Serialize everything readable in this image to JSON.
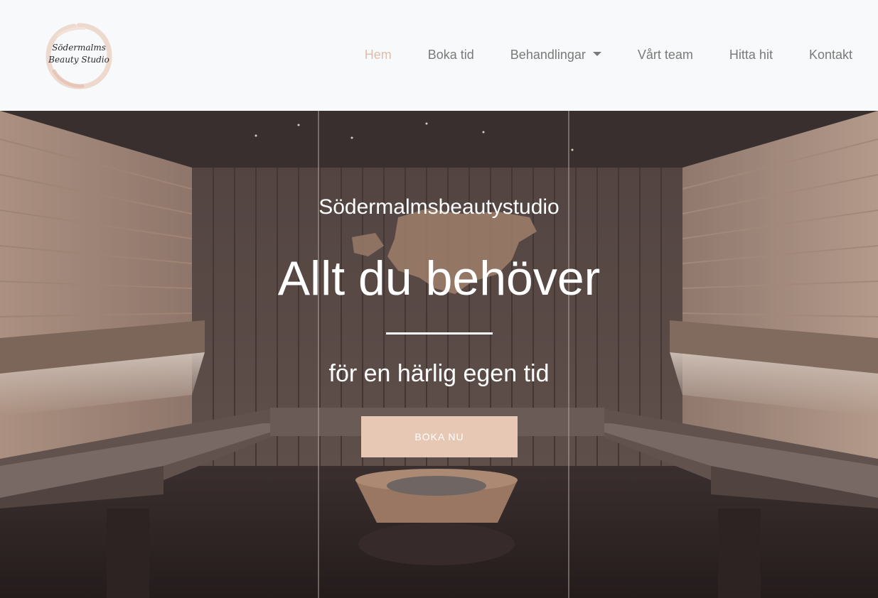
{
  "logo": {
    "line1": "Södermalms",
    "line2": "Beauty Studio"
  },
  "nav": {
    "items": [
      {
        "label": "Hem",
        "active": true
      },
      {
        "label": "Boka tid",
        "active": false
      },
      {
        "label": "Behandlingar",
        "active": false,
        "dropdown": true
      },
      {
        "label": "Vårt team",
        "active": false
      },
      {
        "label": "Hitta hit",
        "active": false
      },
      {
        "label": "Kontakt",
        "active": false
      }
    ]
  },
  "hero": {
    "subtitle": "Södermalmsbeautystudio",
    "title": "Allt du behöver",
    "tagline": "för en härlig egen tid",
    "button_label": "BOKA NU"
  },
  "colors": {
    "accent": "#e2bea9",
    "button": "#e6c8b5",
    "navbar_bg": "#f8f9fa",
    "nav_text": "#7a7a7a"
  },
  "icons": {
    "dropdown": "caret-down-icon"
  }
}
